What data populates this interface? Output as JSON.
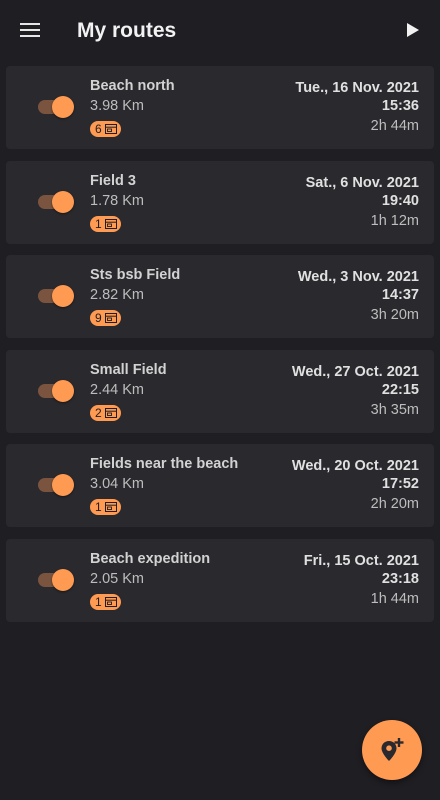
{
  "app": {
    "title": "My routes"
  },
  "colors": {
    "background": "#1f1e23",
    "card": "#2a292e",
    "accent": "#ff9a52",
    "toggle_track": "#7a543e"
  },
  "icons": {
    "menu": "menu-icon",
    "play": "play-icon",
    "badge": "image-stack-icon",
    "fab": "add-location-icon"
  },
  "routes": [
    {
      "name": "Beach north",
      "distance": "3.98 Km",
      "count": "6",
      "date": "Tue., 16 Nov. 2021",
      "time": "15:36",
      "duration": "2h 44m",
      "enabled": true
    },
    {
      "name": "Field 3",
      "distance": "1.78 Km",
      "count": "1",
      "date": "Sat., 6 Nov. 2021",
      "time": "19:40",
      "duration": "1h 12m",
      "enabled": true
    },
    {
      "name": "Sts bsb Field",
      "distance": "2.82 Km",
      "count": "9",
      "date": "Wed., 3 Nov. 2021",
      "time": "14:37",
      "duration": "3h 20m",
      "enabled": true
    },
    {
      "name": "Small Field",
      "distance": "2.44 Km",
      "count": "2",
      "date": "Wed., 27 Oct. 2021",
      "time": "22:15",
      "duration": "3h 35m",
      "enabled": true
    },
    {
      "name": "Fields near the beach",
      "distance": "3.04 Km",
      "count": "1",
      "date": "Wed., 20 Oct. 2021",
      "time": "17:52",
      "duration": "2h 20m",
      "enabled": true
    },
    {
      "name": "Beach expedition",
      "distance": "2.05 Km",
      "count": "1",
      "date": "Fri., 15 Oct. 2021",
      "time": "23:18",
      "duration": "1h 44m",
      "enabled": true
    }
  ]
}
